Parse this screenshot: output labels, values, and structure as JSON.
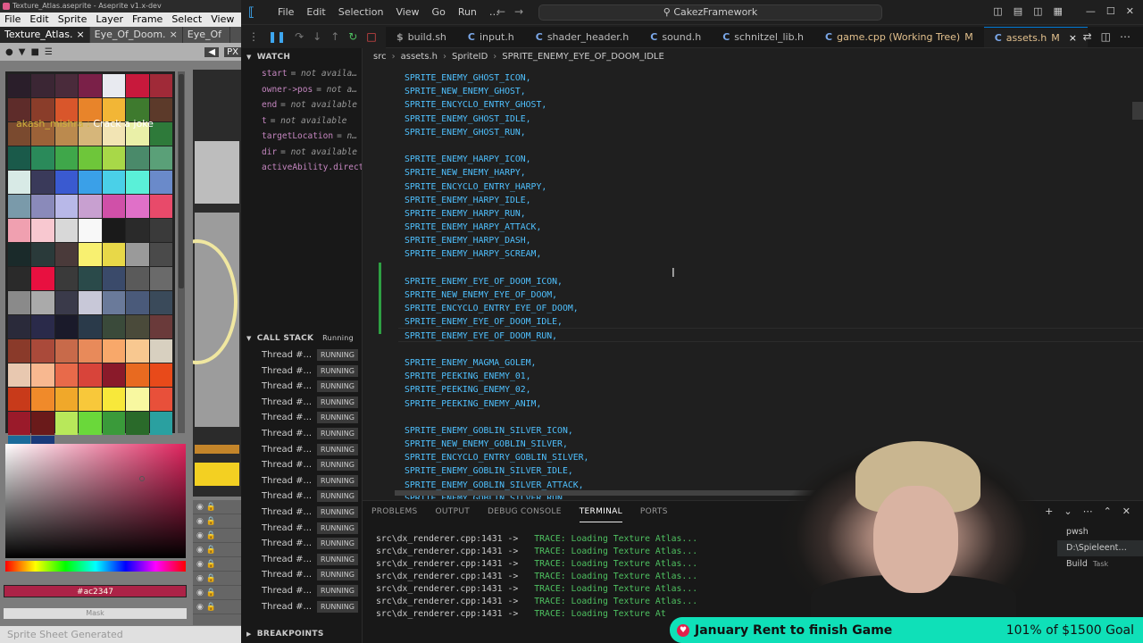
{
  "aseprite": {
    "window_title": "Texture_Atlas.aseprite - Aseprite v1.x-dev",
    "menu": [
      "File",
      "Edit",
      "Sprite",
      "Layer",
      "Frame",
      "Select",
      "View"
    ],
    "tabs": [
      {
        "label": "Texture_Atlas.",
        "close": "×"
      },
      {
        "label": "Eye_Of_Doom.",
        "close": "×"
      },
      {
        "label": "Eye_Of",
        "close": ""
      }
    ],
    "px_label": "PX",
    "chat_user": "akash_mishra :",
    "chat_msg": "Crack a joke",
    "hex_value": "#ac2347",
    "mask_label": "Mask",
    "status": "Sprite Sheet Generated",
    "palette_colors": [
      "#2a1e2a",
      "#3b2634",
      "#4a2b3b",
      "#7a2048",
      "#e8eaf0",
      "#c8193c",
      "#a02a38",
      "#5e2c2a",
      "#8a3d2a",
      "#d9562b",
      "#e8842a",
      "#f2b636",
      "#3e7a2e",
      "#5c3a2a",
      "#7a4a2f",
      "#9c6238",
      "#bb8a4e",
      "#d6b67a",
      "#f2e4b4",
      "#eaf0a8",
      "#2e7a3a",
      "#1a5a4a",
      "#2a8a5a",
      "#3fa74a",
      "#6ec63a",
      "#a8d848",
      "#4a8a6a",
      "#5aa078",
      "#d8eae6",
      "#3a3a5a",
      "#3a5ad0",
      "#3aa0e8",
      "#4ad0e8",
      "#5af0d8",
      "#6a8aca",
      "#7a9aaa",
      "#8a8aba",
      "#b8b8e8",
      "#c8a0d0",
      "#d050a8",
      "#e070c8",
      "#e84a6a",
      "#f0a0b0",
      "#f8c8d0",
      "#d8d8d8",
      "#f8f8f8",
      "#1a1a1a",
      "#2a2a2a",
      "#3a3a3a",
      "#1a2a2a",
      "#2a3a3a",
      "#4a3a3a",
      "#f8f070",
      "#e8d848",
      "#9a9a9a",
      "#4a4a4a",
      "#2a2a2a",
      "#e81040",
      "#3a3a3a",
      "#2a4a4a",
      "#3a4a6a",
      "#5a5a5a",
      "#6a6a6a",
      "#8a8a8a",
      "#aaaaaa",
      "#3a3a4a",
      "#c8c8d8",
      "#6a7a9a",
      "#4a5a7a",
      "#3a4a5a",
      "#2a2a3a",
      "#2a2a4a",
      "#1a1a2a",
      "#2a3a4a",
      "#3a4a3a",
      "#4a4a3a",
      "#6a3a3a",
      "#8a3a2a",
      "#aa4a3a",
      "#c86a4a",
      "#e88a5a",
      "#f8a86a",
      "#f8c890",
      "#d8d0c0",
      "#e8c8b0",
      "#f8b890",
      "#e86a4a",
      "#d8443a",
      "#8a1a2a",
      "#e86a20",
      "#e84a1a",
      "#c83a1a",
      "#f08a2a",
      "#f0a82a",
      "#f8c83a",
      "#f8e83a",
      "#f8f8a0",
      "#e8503a",
      "#9a1a2a",
      "#6a1a1a",
      "#b8e85a",
      "#6ad83a",
      "#3a9a3a",
      "#2a6a2a",
      "#2aa0a0",
      "#1a6a9a",
      "#1a3a7a"
    ],
    "layer_rows": [
      "",
      "",
      "",
      "",
      "",
      "",
      "",
      ""
    ]
  },
  "vscode": {
    "menu": [
      "File",
      "Edit",
      "Selection",
      "View",
      "Go",
      "Run",
      "…"
    ],
    "search": "CakezFramework",
    "tabs": [
      {
        "label": "build.sh",
        "icon": "$",
        "modified": ""
      },
      {
        "label": "input.h",
        "icon": "C",
        "modified": ""
      },
      {
        "label": "shader_header.h",
        "icon": "C",
        "modified": ""
      },
      {
        "label": "sound.h",
        "icon": "C",
        "modified": ""
      },
      {
        "label": "schnitzel_lib.h",
        "icon": "C",
        "modified": ""
      },
      {
        "label": "game.cpp (Working Tree)",
        "icon": "C",
        "modified": "M"
      },
      {
        "label": "assets.h",
        "icon": "C",
        "modified": "M"
      }
    ],
    "tab_close": "×",
    "breadcrumbs": [
      "src",
      "assets.h",
      "SpriteID",
      "SPRITE_ENEMY_EYE_OF_DOOM_IDLE"
    ],
    "watch_title": "WATCH",
    "watch": [
      {
        "name": "start",
        "value": "= not availa…"
      },
      {
        "name": "owner->pos",
        "value": "= not a…"
      },
      {
        "name": "end",
        "value": "= not available"
      },
      {
        "name": "t",
        "value": "= not available"
      },
      {
        "name": "targetLocation",
        "value": "= n…"
      },
      {
        "name": "dir",
        "value": "= not available"
      },
      {
        "name": "activeAbility.direct",
        "value": ""
      }
    ],
    "callstack_title": "CALL STACK",
    "callstack_status": "Running",
    "threads": [
      {
        "name": "Thread #...",
        "state": "RUNNING"
      },
      {
        "name": "Thread #...",
        "state": "RUNNING"
      },
      {
        "name": "Thread #...",
        "state": "RUNNING"
      },
      {
        "name": "Thread #...",
        "state": "RUNNING"
      },
      {
        "name": "Thread #...",
        "state": "RUNNING"
      },
      {
        "name": "Thread #...",
        "state": "RUNNING"
      },
      {
        "name": "Thread #...",
        "state": "RUNNING"
      },
      {
        "name": "Thread #...",
        "state": "RUNNING"
      },
      {
        "name": "Thread #...",
        "state": "RUNNING"
      },
      {
        "name": "Thread #...",
        "state": "RUNNING"
      },
      {
        "name": "Thread #...",
        "state": "RUNNING"
      },
      {
        "name": "Thread #...",
        "state": "RUNNING"
      },
      {
        "name": "Thread #...",
        "state": "RUNNING"
      },
      {
        "name": "Thread #...",
        "state": "RUNNING"
      },
      {
        "name": "Thread #...",
        "state": "RUNNING"
      },
      {
        "name": "Thread #...",
        "state": "RUNNING"
      },
      {
        "name": "Thread #...",
        "state": "RUNNING"
      }
    ],
    "breakpoints_title": "BREAKPOINTS",
    "code_lines": [
      "SPRITE_ENEMY_GHOST_ICON,",
      "SPRITE_NEW_ENEMY_GHOST,",
      "SPRITE_ENCYCLO_ENTRY_GHOST,",
      "SPRITE_ENEMY_GHOST_IDLE,",
      "SPRITE_ENEMY_GHOST_RUN,",
      "",
      "SPRITE_ENEMY_HARPY_ICON,",
      "SPRITE_NEW_ENEMY_HARPY,",
      "SPRITE_ENCYCLO_ENTRY_HARPY,",
      "SPRITE_ENEMY_HARPY_IDLE,",
      "SPRITE_ENEMY_HARPY_RUN,",
      "SPRITE_ENEMY_HARPY_ATTACK,",
      "SPRITE_ENEMY_HARPY_DASH,",
      "SPRITE_ENEMY_HARPY_SCREAM,",
      "",
      "SPRITE_ENEMY_EYE_OF_DOOM_ICON,",
      "SPRITE_NEW_ENEMY_EYE_OF_DOOM,",
      "SPRITE_ENCYCLO_ENTRY_EYE_OF_DOOM,",
      "SPRITE_ENEMY_EYE_OF_DOOM_IDLE,",
      "SPRITE_ENEMY_EYE_OF_DOOM_RUN,",
      "",
      "SPRITE_ENEMY_MAGMA_GOLEM,",
      "SPRITE_PEEKING_ENEMY_01,",
      "SPRITE_PEEKING_ENEMY_02,",
      "SPRITE_PEEKING_ENEMY_ANIM,",
      "",
      "SPRITE_ENEMY_GOBLIN_SILVER_ICON,",
      "SPRITE_NEW_ENEMY_GOBLIN_SILVER,",
      "SPRITE_ENCYCLO_ENTRY_GOBLIN_SILVER,",
      "SPRITE_ENEMY_GOBLIN_SILVER_IDLE,",
      "SPRITE_ENEMY_GOBLIN_SILVER_ATTACK,",
      "SPRITE_ENEMY_GOBLIN_SILVER_RUN,"
    ],
    "panel_tabs": [
      "PROBLEMS",
      "OUTPUT",
      "DEBUG CONSOLE",
      "TERMINAL",
      "PORTS"
    ],
    "terminal_lines": [
      {
        "file": "src\\dx_renderer.cpp:1431 ->",
        "msg": "TRACE: Loading Texture Atlas..."
      },
      {
        "file": "src\\dx_renderer.cpp:1431 ->",
        "msg": "TRACE: Loading Texture Atlas..."
      },
      {
        "file": "src\\dx_renderer.cpp:1431 ->",
        "msg": "TRACE: Loading Texture Atlas..."
      },
      {
        "file": "src\\dx_renderer.cpp:1431 ->",
        "msg": "TRACE: Loading Texture Atlas..."
      },
      {
        "file": "src\\dx_renderer.cpp:1431 ->",
        "msg": "TRACE: Loading Texture Atlas..."
      },
      {
        "file": "src\\dx_renderer.cpp:1431 ->",
        "msg": "TRACE: Loading Texture Atlas..."
      },
      {
        "file": "src\\dx_renderer.cpp:1431 ->",
        "msg": "TRACE: Loading Texture At"
      }
    ],
    "terminals": [
      {
        "name": "pwsh",
        "tag": ""
      },
      {
        "name": "D:\\Spieleent…",
        "tag": ""
      },
      {
        "name": "Build",
        "tag": "Task"
      }
    ]
  },
  "goal_banner": {
    "text": "January Rent to finish Game",
    "progress": "101% of $1500 Goal"
  }
}
